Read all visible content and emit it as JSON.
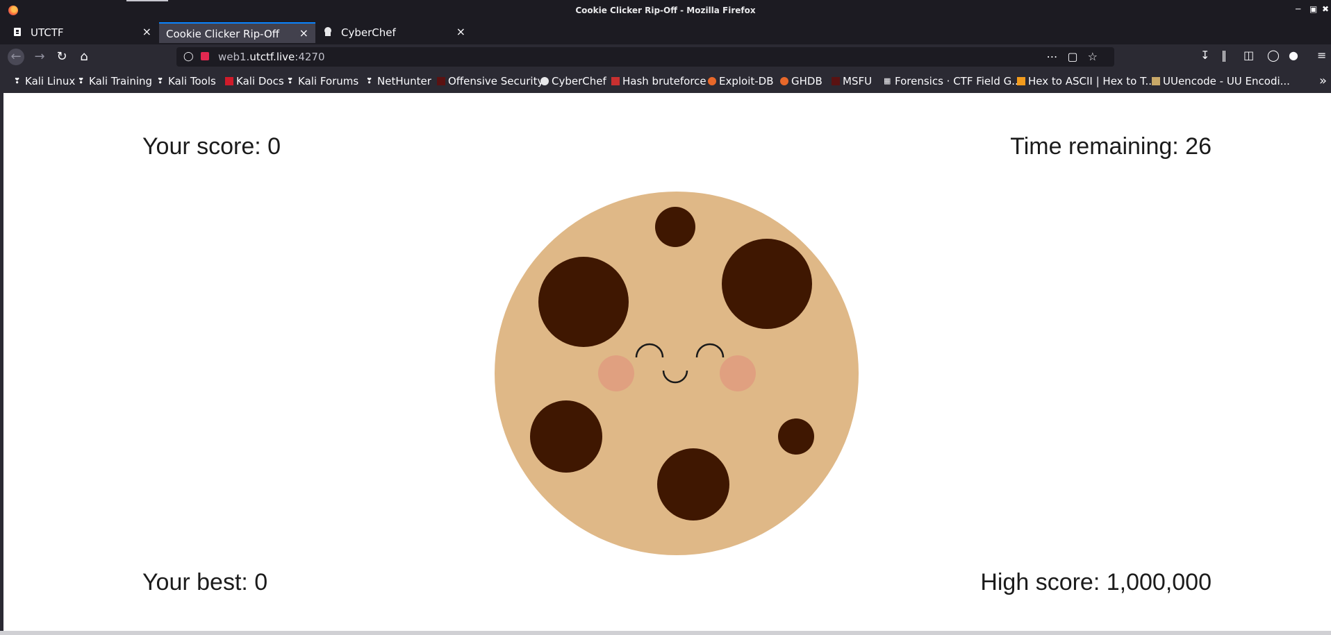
{
  "window": {
    "title": "Cookie Clicker Rip-Off - Mozilla Firefox"
  },
  "tabs": [
    {
      "label": "UTCTF",
      "active": false
    },
    {
      "label": "Cookie Clicker Rip-Off",
      "active": true
    },
    {
      "label": "CyberChef",
      "active": false
    }
  ],
  "urlbar": {
    "prefix": "web1.",
    "host": "utctf.live",
    "port": ":4270"
  },
  "bookmarks": [
    {
      "label": "Kali Linux"
    },
    {
      "label": "Kali Training"
    },
    {
      "label": "Kali Tools"
    },
    {
      "label": "Kali Docs"
    },
    {
      "label": "Kali Forums"
    },
    {
      "label": "NetHunter"
    },
    {
      "label": "Offensive Security"
    },
    {
      "label": "CyberChef"
    },
    {
      "label": "Hash bruteforce"
    },
    {
      "label": "Exploit-DB"
    },
    {
      "label": "GHDB"
    },
    {
      "label": "MSFU"
    },
    {
      "label": "Forensics · CTF Field G..."
    },
    {
      "label": "Hex to ASCII | Hex to T..."
    },
    {
      "label": "UUencode - UU Encodi..."
    }
  ],
  "game": {
    "score_text": "Your score: 0",
    "time_text": "Time remaining: 26",
    "best_text": "Your best: 0",
    "high_text": "High score: 1,000,000"
  },
  "colors": {
    "cookie": "#dfb887",
    "chip": "#3f1701",
    "cheek": "#e0a080",
    "face": "#1a1a1a",
    "tab_accent": "#0a84ff"
  }
}
